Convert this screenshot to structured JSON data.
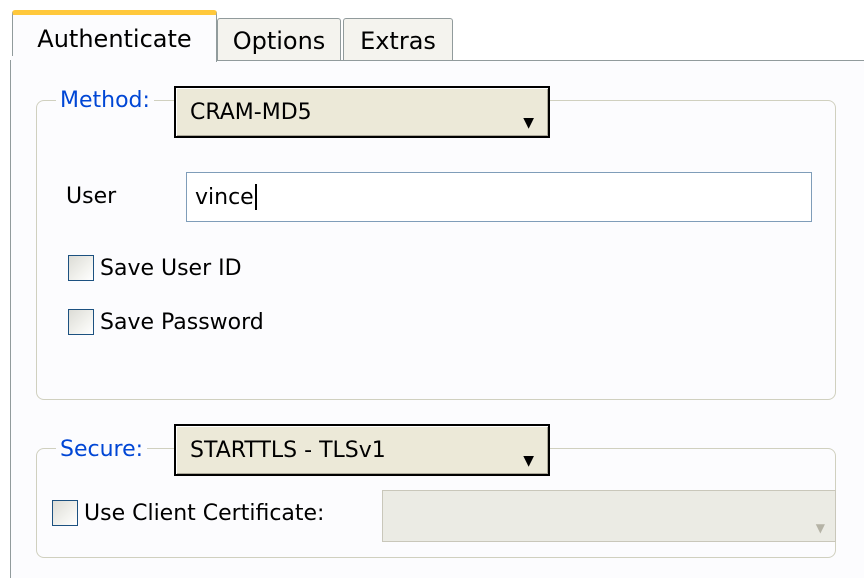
{
  "tabs": [
    {
      "label": "Authenticate",
      "active": true
    },
    {
      "label": "Options",
      "active": false
    },
    {
      "label": "Extras",
      "active": false
    }
  ],
  "auth_group": {
    "method_label": "Method:",
    "method_value": "CRAM-MD5",
    "user_label": "User",
    "user_value": "vince",
    "save_user_label": "Save User ID",
    "save_user_checked": false,
    "save_password_label": "Save Password",
    "save_password_checked": false
  },
  "secure_group": {
    "secure_label": "Secure:",
    "secure_value": "STARTTLS - TLSv1",
    "client_cert_label": "Use Client Certificate:",
    "client_cert_checked": false,
    "client_cert_value": ""
  },
  "icons": {
    "dropdown_arrow": "chevron-down-icon"
  },
  "colors": {
    "legend_blue": "#0046d5",
    "active_tab_accent": "#ffc83c",
    "input_border": "#7f9db9"
  }
}
